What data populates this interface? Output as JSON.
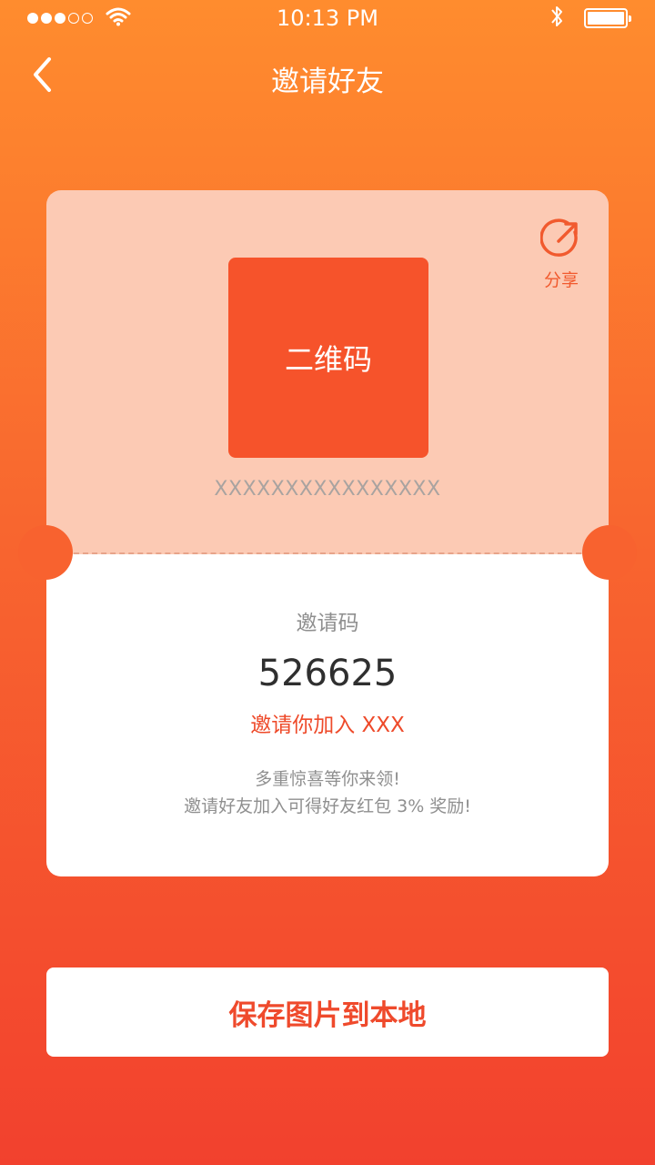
{
  "status_bar": {
    "time": "10:13 PM",
    "signal_icon": "signal-dots-icon",
    "wifi_icon": "wifi-icon",
    "bluetooth_icon": "bluetooth-icon",
    "battery_icon": "battery-icon"
  },
  "nav": {
    "title": "邀请好友",
    "back_icon": "chevron-left-icon"
  },
  "card": {
    "share": {
      "label": "分享",
      "icon": "share-icon"
    },
    "qr": {
      "label": "二维码"
    },
    "qr_caption": "XXXXXXXXXXXXXXXX",
    "invite_label": "邀请码",
    "invite_code": "526625",
    "invite_join": "邀请你加入 XXX",
    "description_line1": "多重惊喜等你来领!",
    "description_line2": "邀请好友加入可得好友红包 3% 奖励!"
  },
  "save_button": {
    "label": "保存图片到本地"
  },
  "colors": {
    "accent": "#f15a2e",
    "card_top": "#fccab4",
    "qr_bg": "#f6532b"
  }
}
